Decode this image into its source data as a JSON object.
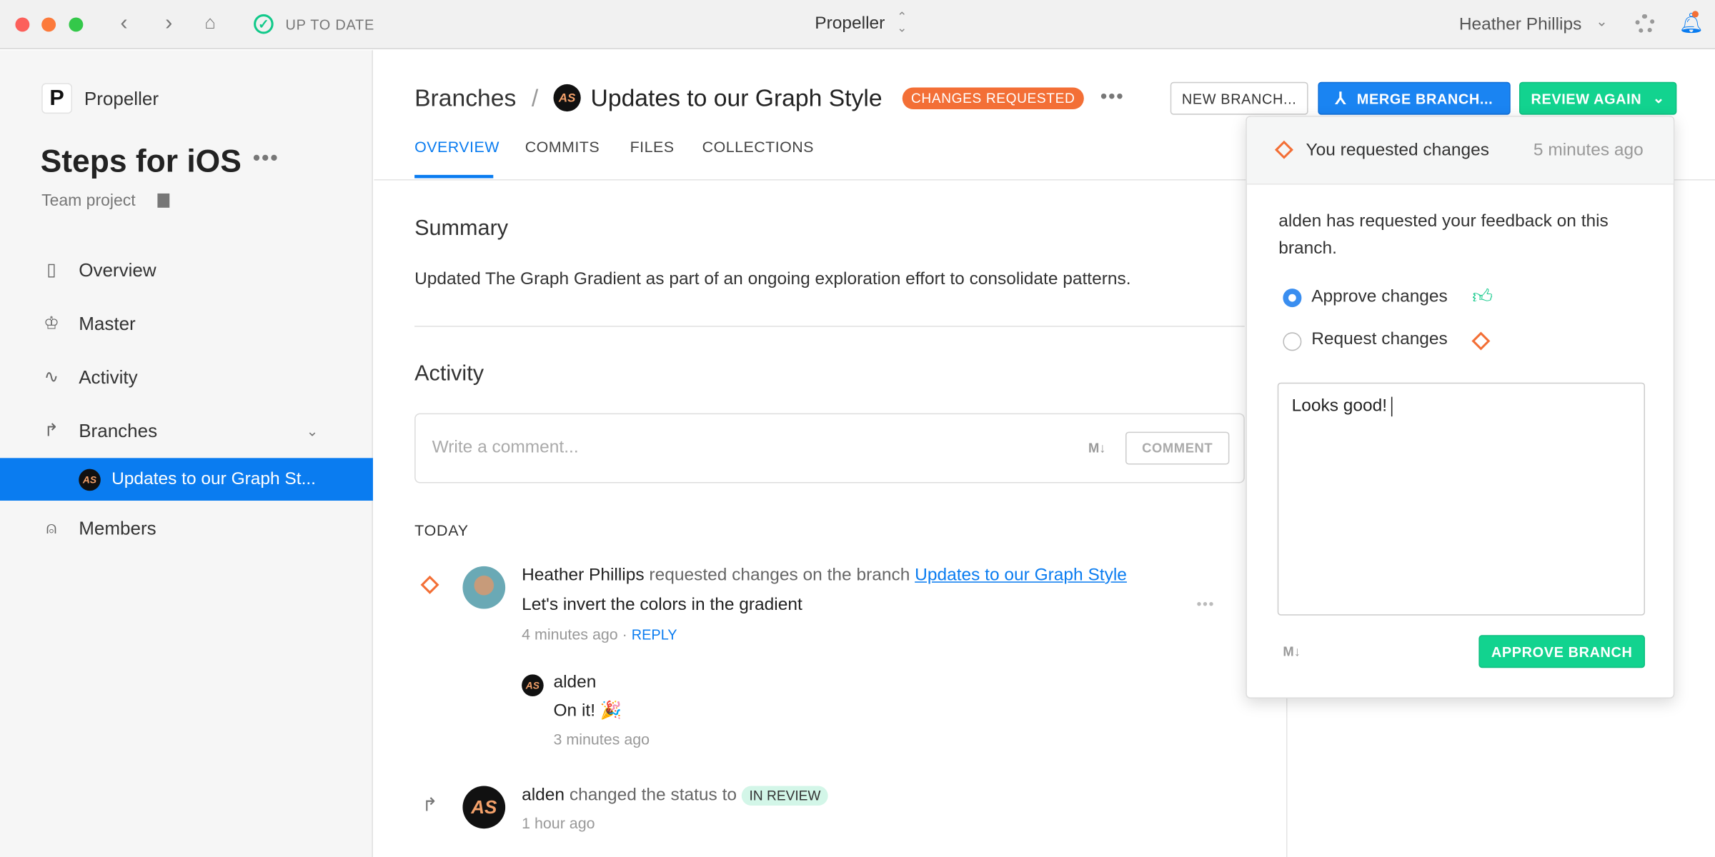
{
  "titlebar": {
    "status": "UP TO DATE",
    "project": "Propeller",
    "user": "Heather Phillips"
  },
  "sidebar": {
    "app_name": "Propeller",
    "project_title": "Steps for iOS",
    "project_type": "Team project",
    "items": [
      {
        "label": "Overview",
        "icon": "notebook-icon"
      },
      {
        "label": "Master",
        "icon": "crown-icon"
      },
      {
        "label": "Activity",
        "icon": "pulse-icon"
      },
      {
        "label": "Branches",
        "icon": "branch-icon"
      },
      {
        "label": "Updates to our Graph St...",
        "icon": "avatar"
      },
      {
        "label": "Members",
        "icon": "person-icon"
      }
    ]
  },
  "header": {
    "breadcrumb_root": "Branches",
    "separator": "/",
    "branch_title": "Updates to our Graph Style",
    "status_badge": "CHANGES REQUESTED",
    "new_branch": "NEW BRANCH...",
    "merge_branch": "MERGE BRANCH...",
    "review_again": "REVIEW AGAIN"
  },
  "tabs": [
    "OVERVIEW",
    "COMMITS",
    "FILES",
    "COLLECTIONS"
  ],
  "summary": {
    "title": "Summary",
    "text": "Updated The Graph Gradient as part of an ongoing exploration effort to consolidate patterns."
  },
  "activity": {
    "title": "Activity",
    "comment_placeholder": "Write a comment...",
    "markdown": "M↓",
    "comment_button": "COMMENT",
    "day": "TODAY",
    "entry1": {
      "author": "Heather Phillips",
      "action": "requested changes on the branch",
      "link": "Updates to our Graph Style",
      "message": "Let's invert the colors in the gradient",
      "time": "4 minutes ago",
      "reply": "REPLY",
      "sep": "·"
    },
    "reply1": {
      "author": "alden",
      "message": "On it! 🎉",
      "time": "3 minutes ago"
    },
    "entry2": {
      "author": "alden",
      "action": "changed the status to",
      "badge": "IN REVIEW",
      "time": "1 hour ago"
    }
  },
  "popover": {
    "header": "You requested changes",
    "header_time": "5 minutes ago",
    "prompt": "alden has requested your feedback on this branch.",
    "approve": "Approve changes",
    "request": "Request changes",
    "comment_value": "Looks good!",
    "markdown": "M↓",
    "approve_button": "APPROVE BRANCH",
    "selected": "approve"
  },
  "colors": {
    "accent": "#0a7cf0",
    "green": "#12d38f",
    "orange": "#f36f36"
  }
}
